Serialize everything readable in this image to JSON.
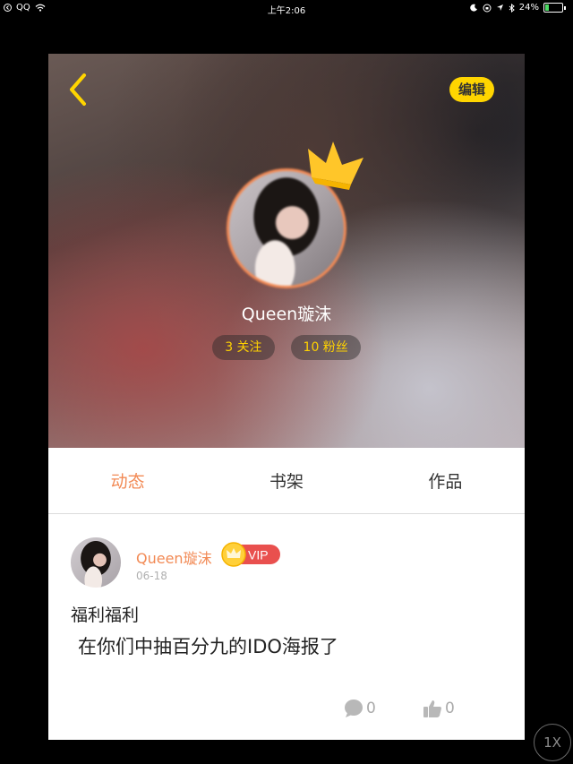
{
  "status_bar": {
    "carrier": "QQ",
    "time": "上午2:06",
    "battery": "24%",
    "icons": [
      "back-to-app-icon",
      "wifi-icon",
      "moon-icon",
      "orientation-lock-icon",
      "location-icon",
      "bluetooth-icon",
      "battery-icon"
    ]
  },
  "header": {
    "back_icon": "chevron-left-icon",
    "edit_label": "编辑"
  },
  "profile": {
    "username": "Queen璇沫",
    "following": "3 关注",
    "fans": "10 粉丝",
    "crown_icon": "crown-icon"
  },
  "tabs": [
    {
      "label": "动态",
      "active": true
    },
    {
      "label": "书架",
      "active": false
    },
    {
      "label": "作品",
      "active": false
    }
  ],
  "post": {
    "author": "Queen璇沫",
    "badge": "VIP",
    "date": "06-18",
    "title": "福利福利",
    "body": "在你们中抽百分九的IDO海报了",
    "comments": "0",
    "likes": "0"
  },
  "zoom_label": "1X",
  "colors": {
    "accent": "#f28a55",
    "edit_button": "#ffd500",
    "pill_text": "#ffd200",
    "vip_red": "#e9504e"
  }
}
